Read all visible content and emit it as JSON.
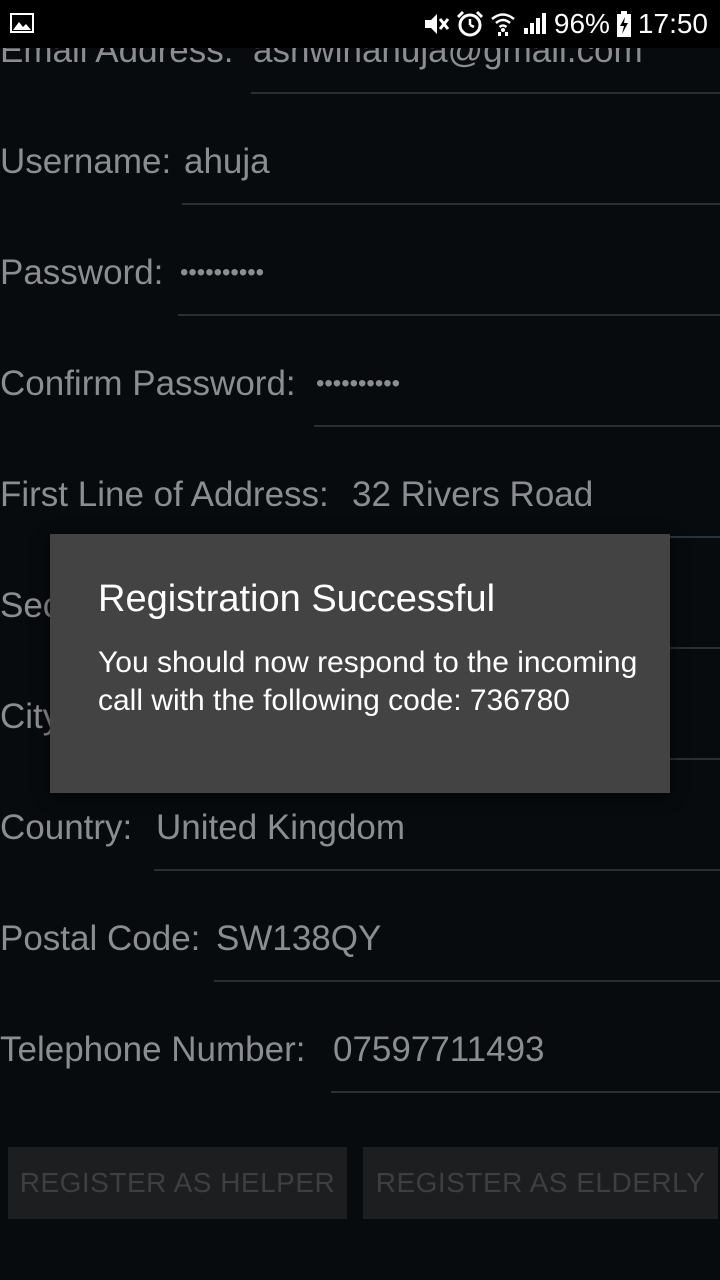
{
  "status_bar": {
    "battery": "96%",
    "time": "17:50",
    "icons": [
      "gallery-icon",
      "mute-icon",
      "alarm-icon",
      "wifi-icon",
      "signal-icon",
      "battery-charging-icon"
    ]
  },
  "form": {
    "email_label": "Email Address:",
    "email_value": "ashwinahuja@gmail.com",
    "username_label": "Username:",
    "username_value": "ahuja",
    "password_label": "Password:",
    "password_value": "••••••••••",
    "confirm_password_label": "Confirm Password:",
    "confirm_password_value": "••••••••••",
    "address1_label": "First Line of Address:",
    "address1_value": "32 Rivers Road",
    "address2_label": "Sec",
    "city_label": "City",
    "country_label": "Country:",
    "country_value": "United Kingdom",
    "postal_label": "Postal Code:",
    "postal_value": "SW138QY",
    "phone_label": "Telephone Number:",
    "phone_value": "07597711493"
  },
  "buttons": {
    "helper": "REGISTER AS HELPER",
    "elderly": "REGISTER AS ELDERLY"
  },
  "dialog": {
    "title": "Registration Successful",
    "message": "You should now respond to the incoming call with the following code: 736780"
  }
}
